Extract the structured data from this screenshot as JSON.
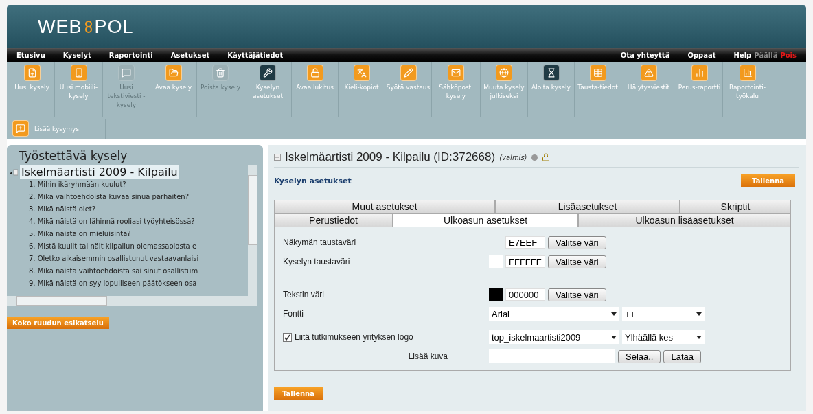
{
  "logo": {
    "left": "WEB",
    "right": "POL"
  },
  "menu": {
    "left": [
      "Etusivu",
      "Kyselyt",
      "Raportointi",
      "Asetukset",
      "Käyttäjätiedot"
    ],
    "right": [
      "Ota yhteyttä",
      "Oppaat"
    ],
    "help": {
      "label": "Help",
      "options": [
        {
          "label": "Päällä",
          "selected": false
        },
        {
          "label": "Pois",
          "selected": true
        }
      ]
    }
  },
  "toolbar": [
    {
      "label": "Uusi kysely",
      "kind": "orange",
      "disabled": false
    },
    {
      "label": "Uusi mobiili-kysely",
      "kind": "orange",
      "disabled": false
    },
    {
      "label": "Uusi tekstiviesti -kysely",
      "kind": "dark",
      "disabled": true
    },
    {
      "label": "Avaa kysely",
      "kind": "orange",
      "disabled": false
    },
    {
      "label": "Poista kysely",
      "kind": "dark",
      "disabled": true
    },
    {
      "label": "Kyselyn asetukset",
      "kind": "dark",
      "disabled": false
    },
    {
      "label": "Avaa lukitus",
      "kind": "orange",
      "disabled": false
    },
    {
      "label": "Kieli-kopiot",
      "kind": "orange",
      "disabled": false
    },
    {
      "label": "Syötä vastaus",
      "kind": "orange",
      "disabled": false
    },
    {
      "label": "Sähköposti kysely",
      "kind": "orange",
      "disabled": false
    },
    {
      "label": "Muuta kysely julkiseksi",
      "kind": "orange",
      "disabled": false
    },
    {
      "label": "Aloita kysely",
      "kind": "dark",
      "disabled": false
    },
    {
      "label": "Tausta-tiedot",
      "kind": "orange",
      "disabled": false
    },
    {
      "label": "Hälytysviestit",
      "kind": "orange",
      "disabled": false
    },
    {
      "label": "Perus-raportti",
      "kind": "orange",
      "disabled": false
    },
    {
      "label": "Raportointi-työkalu",
      "kind": "orange",
      "disabled": false
    }
  ],
  "add_question": "Lisää kysymys",
  "sidebar": {
    "title": "Työstettävä kysely",
    "tree": {
      "label": "Iskelmäartisti 2009 - Kilpailu",
      "selected": true,
      "expanded": true,
      "children": [
        {
          "label": "1. Mihin ikäryhmään kuulut?"
        },
        {
          "label": "2. Mikä vaihtoehdoista kuvaa sinua parhaiten?"
        },
        {
          "label": "3. Mikä näistä olet?"
        },
        {
          "label": "4. Mikä näistä on lähinnä rooliasi työyhteisössä?"
        },
        {
          "label": "5. Mikä näistä on mieluisinta?"
        },
        {
          "label": "6. Mistä kuulit tai näit kilpailun olemassaolosta e"
        },
        {
          "label": "7. Oletko aikaisemmin osallistunut vastaavanlaisi"
        },
        {
          "label": "8. Mikä näistä vaihtoehdoista sai sinut osallistum"
        },
        {
          "label": "9. Mikä näistä on syy lopulliseen päätökseen osa"
        }
      ]
    },
    "preview_button": "Koko ruudun esikatselu"
  },
  "main": {
    "title": "Iskelmäartisti 2009 - Kilpailu (ID:372668)",
    "status": "(valmis)",
    "section": "Kyselyn asetukset",
    "save_top": "Tallenna",
    "tabs_back": [
      {
        "label": "Muut asetukset",
        "selected": false
      },
      {
        "label": "Lisäasetukset",
        "selected": false
      },
      {
        "label": "Skriptit",
        "selected": false
      }
    ],
    "tabs_front": [
      {
        "label": "Perustiedot",
        "selected": false
      },
      {
        "label": "Ulkoasun asetukset",
        "selected": true
      },
      {
        "label": "Ulkoasun lisäasetukset",
        "selected": false
      }
    ],
    "color_rows": [
      {
        "label": "Näkymän taustaväri",
        "value": "E7EEF",
        "button": "Valitse väri"
      },
      {
        "label": "Kyselyn taustaväri",
        "value": "FFFFFF",
        "color": "#ffffff",
        "button": "Valitse väri"
      },
      {
        "label": "Tekstin väri",
        "value": "000000",
        "color": "#000000",
        "button": "Valitse väri"
      }
    ],
    "font": {
      "label": "Fontti",
      "family": "Arial",
      "size": "++"
    },
    "logo": {
      "label": "Liitä tutkimukseen yrityksen logo",
      "checked": true,
      "file": "top_iskelmaartisti2009",
      "position": "Ylhäällä kes"
    },
    "image": {
      "label": "Lisää kuva",
      "browse": "Selaa..",
      "upload": "Lataa"
    },
    "save_bottom": "Tallenna"
  }
}
